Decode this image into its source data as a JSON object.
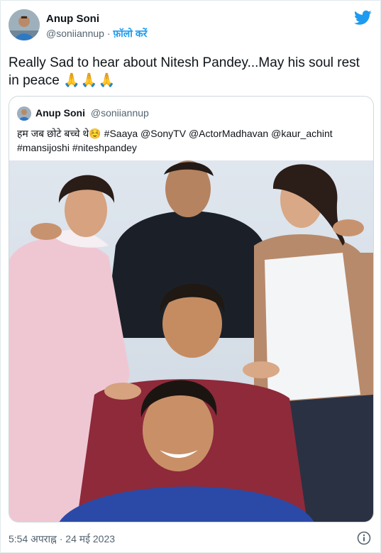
{
  "author": {
    "name": "Anup Soni",
    "handle": "@soniiannup",
    "separator": "·",
    "follow_label": "फ़ॉलो करें"
  },
  "tweet": {
    "text": "Really Sad to hear about Nitesh Pandey...May his soul rest in peace",
    "emoji": "🙏🙏🙏"
  },
  "quoted": {
    "name": "Anup Soni",
    "handle": "@soniiannup",
    "text": "हम जब छोटे बच्चे थे☺️ #Saaya @SonyTV @ActorMadhavan @kaur_achint #mansijoshi #niteshpandey"
  },
  "footer": {
    "timestamp": "5:54 अपराह्न · 24 मई 2023"
  },
  "icons": {
    "brand": "twitter-bird-icon",
    "info": "info-icon"
  },
  "colors": {
    "link": "#1d9bf0",
    "secondary_text": "#536471",
    "border": "#cfd9de"
  }
}
